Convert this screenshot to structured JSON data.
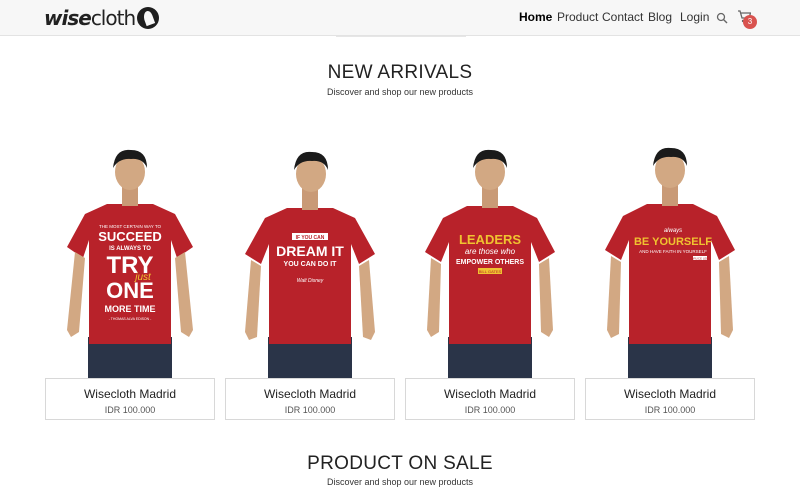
{
  "brand": {
    "prefix": "wise",
    "suffix": "cloth"
  },
  "nav": {
    "items": [
      "Home",
      "Product",
      "Contact",
      "Blog",
      "Login"
    ],
    "active": "Home",
    "cart_count": "3"
  },
  "new_arrivals": {
    "title": "NEW ARRIVALS",
    "subtitle": "Discover and shop our new products"
  },
  "products": [
    {
      "name": "Wisecloth Madrid",
      "price": "IDR 100.000",
      "shirt_text": [
        "THE MOST CERTAIN WAY TO",
        "SUCCEED",
        "IS ALWAYS TO",
        "TRY",
        "just",
        "ONE",
        "MORE TIME",
        "- THOMAS ALVA EDISON -"
      ]
    },
    {
      "name": "Wisecloth Madrid",
      "price": "IDR 100.000",
      "shirt_text": [
        "IF YOU CAN",
        "DREAM IT",
        "YOU CAN DO IT",
        "Walt Disney"
      ]
    },
    {
      "name": "Wisecloth Madrid",
      "price": "IDR 100.000",
      "shirt_text": [
        "LEADERS",
        "are those who",
        "EMPOWER OTHERS",
        "BILL GATES"
      ]
    },
    {
      "name": "Wisecloth Madrid",
      "price": "IDR 100.000",
      "shirt_text": [
        "always",
        "BE YOURSELF",
        "AND HAVE FAITH IN YOURSELF",
        "BRUCE LEE"
      ]
    }
  ],
  "on_sale": {
    "title": "PRODUCT ON SALE",
    "subtitle": "Discover and shop our new products"
  },
  "colors": {
    "shirt": "#b8222a",
    "accent": "#d9534f",
    "print_yellow": "#f0c330"
  }
}
